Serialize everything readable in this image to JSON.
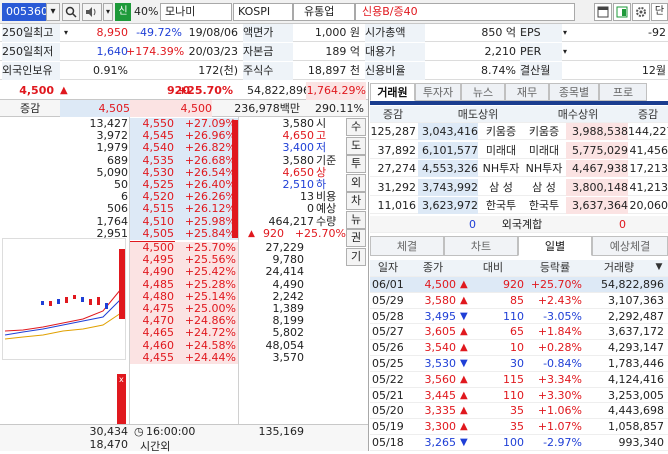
{
  "toolbar": {
    "code": "005360",
    "search_icon": "search-icon",
    "sound_icon": "speaker-icon",
    "credit_badge": "신",
    "margin_rate": "40%",
    "name": "모나미",
    "market": "KOSPI",
    "sector": "유통업",
    "credit_info": "신용B/증40",
    "corner_label": "단"
  },
  "info": [
    {
      "l1": "250일최고",
      "v1": "8,950",
      "c1": "-49.72%",
      "d1": "19/08/06",
      "l2": "액면가",
      "v2": "1,000 원",
      "l3": "시가총액",
      "v3": "850 억",
      "l4": "EPS",
      "v4": "-92"
    },
    {
      "l1": "250일최저",
      "v1": "1,640",
      "c1": "+174.39%",
      "d1": "20/03/23",
      "l2": "자본금",
      "v2": "189 억",
      "l3": "대용가",
      "v3": "2,210",
      "l4": "PER",
      "v4": ""
    },
    {
      "l1": "외국인보유",
      "v1": "0.91%",
      "c1": "",
      "d1": "172(천)",
      "l2": "주식수",
      "v2": "18,897 천",
      "l3": "신용비율",
      "v3": "8.74%",
      "l4": "결산월",
      "v4": "12월"
    }
  ],
  "quote": {
    "price": "4,500",
    "change": "920",
    "rate": "+25.70%",
    "volume": "54,822,896",
    "vol_rate": "1,764.29%",
    "incr_label": "증감",
    "incr_price1": "4,505",
    "incr_price2": "4,500",
    "amount": "236,978백만",
    "amount_rate": "290.11%"
  },
  "asks": [
    {
      "qty": "13,427",
      "price": "4,550",
      "rate": "+27.09%"
    },
    {
      "qty": "3,972",
      "price": "4,545",
      "rate": "+26.96%"
    },
    {
      "qty": "1,979",
      "price": "4,540",
      "rate": "+26.82%"
    },
    {
      "qty": "689",
      "price": "4,535",
      "rate": "+26.68%"
    },
    {
      "qty": "5,090",
      "price": "4,530",
      "rate": "+26.54%"
    },
    {
      "qty": "50",
      "price": "4,525",
      "rate": "+26.40%"
    },
    {
      "qty": "6",
      "price": "4,520",
      "rate": "+26.26%"
    },
    {
      "qty": "506",
      "price": "4,515",
      "rate": "+26.12%"
    },
    {
      "qty": "1,764",
      "price": "4,510",
      "rate": "+25.98%"
    },
    {
      "qty": "2,951",
      "price": "4,505",
      "rate": "+25.84%"
    }
  ],
  "bids": [
    {
      "qty": "27,229",
      "price": "4,500",
      "rate": "+25.70%"
    },
    {
      "qty": "9,780",
      "price": "4,495",
      "rate": "+25.56%"
    },
    {
      "qty": "24,414",
      "price": "4,490",
      "rate": "+25.42%"
    },
    {
      "qty": "4,490",
      "price": "4,485",
      "rate": "+25.28%"
    },
    {
      "qty": "2,242",
      "price": "4,480",
      "rate": "+25.14%"
    },
    {
      "qty": "1,389",
      "price": "4,475",
      "rate": "+25.00%"
    },
    {
      "qty": "8,199",
      "price": "4,470",
      "rate": "+24.86%"
    },
    {
      "qty": "5,802",
      "price": "4,465",
      "rate": "+24.72%"
    },
    {
      "qty": "48,054",
      "price": "4,460",
      "rate": "+24.58%"
    },
    {
      "qty": "3,570",
      "price": "4,455",
      "rate": "+24.44%"
    }
  ],
  "stats": [
    {
      "value": "3,580",
      "label": "시"
    },
    {
      "value": "4,650",
      "label": "고"
    },
    {
      "value": "3,400",
      "label": "저"
    },
    {
      "value": "3,580",
      "label": "기준"
    },
    {
      "value": "4,650",
      "label": "상"
    },
    {
      "value": "2,510",
      "label": "하"
    },
    {
      "value": "13",
      "label": "비용"
    },
    {
      "value": "0",
      "label": "예상"
    },
    {
      "value": "464,217",
      "label": "수량"
    }
  ],
  "expected": {
    "price": "920",
    "rate": "+25.70%"
  },
  "side_buttons": [
    "수",
    "도",
    "투",
    "외",
    "차",
    "뉴",
    "권",
    "기"
  ],
  "totals": {
    "ask_total": "30,434",
    "time": "16:00:00",
    "bid_total": "135,169",
    "after_qty": "18,470",
    "after_label": "시간외"
  },
  "broker_tabs": [
    "거래원",
    "투자자",
    "뉴스",
    "재무",
    "종목별",
    "프로"
  ],
  "broker_header": {
    "incr": "증감",
    "sell": "매도상위",
    "buy": "매수상위",
    "incr2": "증감"
  },
  "brokers": [
    {
      "sinc": "125,287",
      "sqty": "3,043,416",
      "sname": "키움증",
      "bname": "키움증",
      "bqty": "3,988,538",
      "binc": "144,227"
    },
    {
      "sinc": "37,892",
      "sqty": "6,101,577",
      "sname": "미래대",
      "bname": "미래대",
      "bqty": "5,775,029",
      "binc": "41,456"
    },
    {
      "sinc": "27,274",
      "sqty": "4,553,326",
      "sname": "NH투자",
      "bname": "NH투자",
      "bqty": "4,467,938",
      "binc": "17,213"
    },
    {
      "sinc": "31,292",
      "sqty": "3,743,992",
      "sname": "삼 성",
      "bname": "삼 성",
      "bqty": "3,800,148",
      "binc": "41,213"
    },
    {
      "sinc": "11,016",
      "sqty": "3,623,972",
      "sname": "한국투",
      "bname": "한국투",
      "bqty": "3,637,364",
      "binc": "20,060"
    }
  ],
  "foreign_total": {
    "left": "0",
    "label": "외국계합",
    "right": "0"
  },
  "daily_tabs": [
    "체결",
    "차트",
    "일별",
    "예상체결"
  ],
  "daily_header": {
    "date": "일자",
    "close": "종가",
    "diff": "대비",
    "rate": "등락률",
    "volume": "거래량"
  },
  "daily": [
    {
      "date": "06/01",
      "close": "4,500",
      "dir": "up",
      "diff": "920",
      "rate": "+25.70%",
      "volume": "54,822,896"
    },
    {
      "date": "05/29",
      "close": "3,580",
      "dir": "up",
      "diff": "85",
      "rate": "+2.43%",
      "volume": "3,107,363"
    },
    {
      "date": "05/28",
      "close": "3,495",
      "dir": "down",
      "diff": "110",
      "rate": "-3.05%",
      "volume": "2,292,487"
    },
    {
      "date": "05/27",
      "close": "3,605",
      "dir": "up",
      "diff": "65",
      "rate": "+1.84%",
      "volume": "3,637,172"
    },
    {
      "date": "05/26",
      "close": "3,540",
      "dir": "up",
      "diff": "10",
      "rate": "+0.28%",
      "volume": "4,293,147"
    },
    {
      "date": "05/25",
      "close": "3,530",
      "dir": "down",
      "diff": "30",
      "rate": "-0.84%",
      "volume": "1,783,446"
    },
    {
      "date": "05/22",
      "close": "3,560",
      "dir": "up",
      "diff": "115",
      "rate": "+3.34%",
      "volume": "4,124,416"
    },
    {
      "date": "05/21",
      "close": "3,445",
      "dir": "up",
      "diff": "110",
      "rate": "+3.30%",
      "volume": "3,253,005"
    },
    {
      "date": "05/20",
      "close": "3,335",
      "dir": "up",
      "diff": "35",
      "rate": "+1.06%",
      "volume": "4,443,698"
    },
    {
      "date": "05/19",
      "close": "3,300",
      "dir": "up",
      "diff": "35",
      "rate": "+1.07%",
      "volume": "1,058,857"
    },
    {
      "date": "05/18",
      "close": "3,265",
      "dir": "down",
      "diff": "100",
      "rate": "-2.97%",
      "volume": "993,340"
    }
  ],
  "colors": {
    "up": "#e0181e",
    "down": "#1f3fd6",
    "ask_bg": "#dde9f6",
    "bid_bg": "#fbe3e3",
    "active_tab": "#1a3d8f"
  }
}
